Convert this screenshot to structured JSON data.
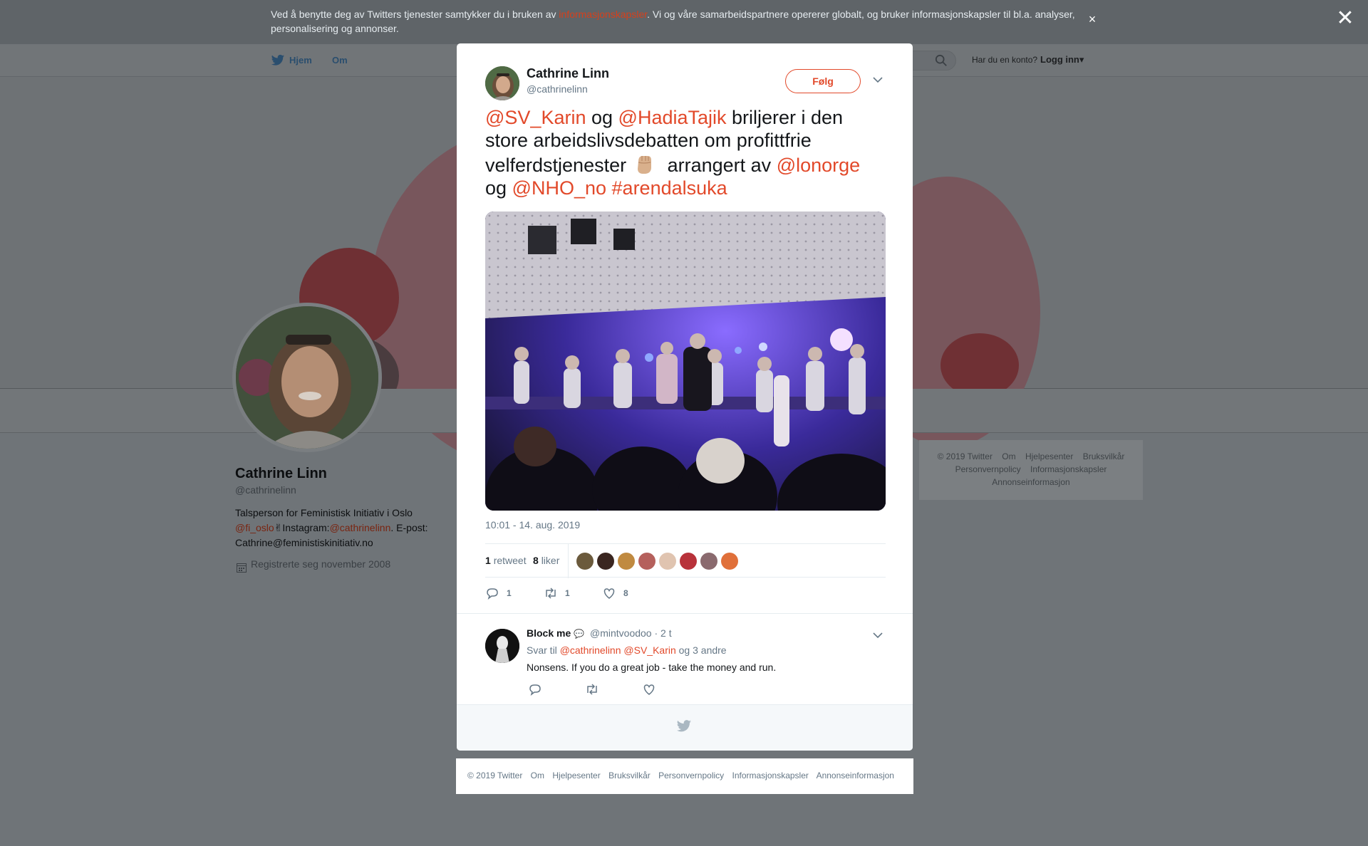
{
  "cookie": {
    "text_before": "Ved å benytte deg av Twitters tjenester samtykker du i bruken av ",
    "link": "informasjonskapsler",
    "text_after": ". Vi og våre samarbeidspartnere opererer globalt, og bruker informasjonskapsler til bl.a. analyser, personalisering og annonser.",
    "close": "×"
  },
  "overlay": {
    "close": "✕"
  },
  "nav": {
    "home": "Hjem",
    "about": "Om",
    "account_q": "Har du en konto?",
    "login": "Logg inn",
    "login_caret": "▾"
  },
  "profile": {
    "name": "Cathrine Linn",
    "handle": "@cathrinelinn",
    "bio_line1": "Talsperson for Feministisk Initiativ i Oslo",
    "bio_link1": "@fi_oslo",
    "bio_emoji": "✌",
    "bio_mid": "Instagram:",
    "bio_link2": "@cathrinelinn",
    "bio_end": ". E-post: Cathrine@feministiskinitiativ.no",
    "joined": "Registrerte seg november 2008"
  },
  "side_footer": {
    "links": [
      "© 2019 Twitter",
      "Om",
      "Hjelpesenter",
      "Bruksvilkår",
      "Personvernpolicy",
      "Informasjonskapsler",
      "Annonseinformasjon"
    ]
  },
  "tweet": {
    "name": "Cathrine Linn",
    "handle": "@cathrinelinn",
    "follow": "Følg",
    "mention1": "@SV_Karin",
    "og1": " og ",
    "mention2": "@HadiaTajik",
    "text1": " briljerer i den store arbeidslivsdebatten om profittfrie velferdstjenester",
    "text2": " arrangert av ",
    "mention3": "@lonorge",
    "og2": "og ",
    "mention4": "@NHO_no",
    "hashtag": "#arendalsuka",
    "time": "10:01 - 14. aug. 2019",
    "retweets_count": "1",
    "retweets_label": "retweet",
    "likes_count": "8",
    "likes_label": "liker",
    "reply_n": "1",
    "retweet_n": "1",
    "like_n": "8"
  },
  "reply": {
    "name": "Block me",
    "emoji": "💬",
    "handle": "@mintvoodoo",
    "time": "· 2 t",
    "to_label": "Svar til ",
    "to1": "@cathrinelinn",
    "to2": "@SV_Karin",
    "to_more": " og 3 andre",
    "text": "Nonsens. If you do a great job - take the money and run."
  },
  "footer": {
    "links": [
      "© 2019 Twitter",
      "Om",
      "Hjelpesenter",
      "Bruksvilkår",
      "Personvernpolicy",
      "Informasjonskapsler",
      "Annonseinformasjon"
    ]
  },
  "colors": {
    "accent": "#e2492a",
    "muted": "#657786"
  }
}
